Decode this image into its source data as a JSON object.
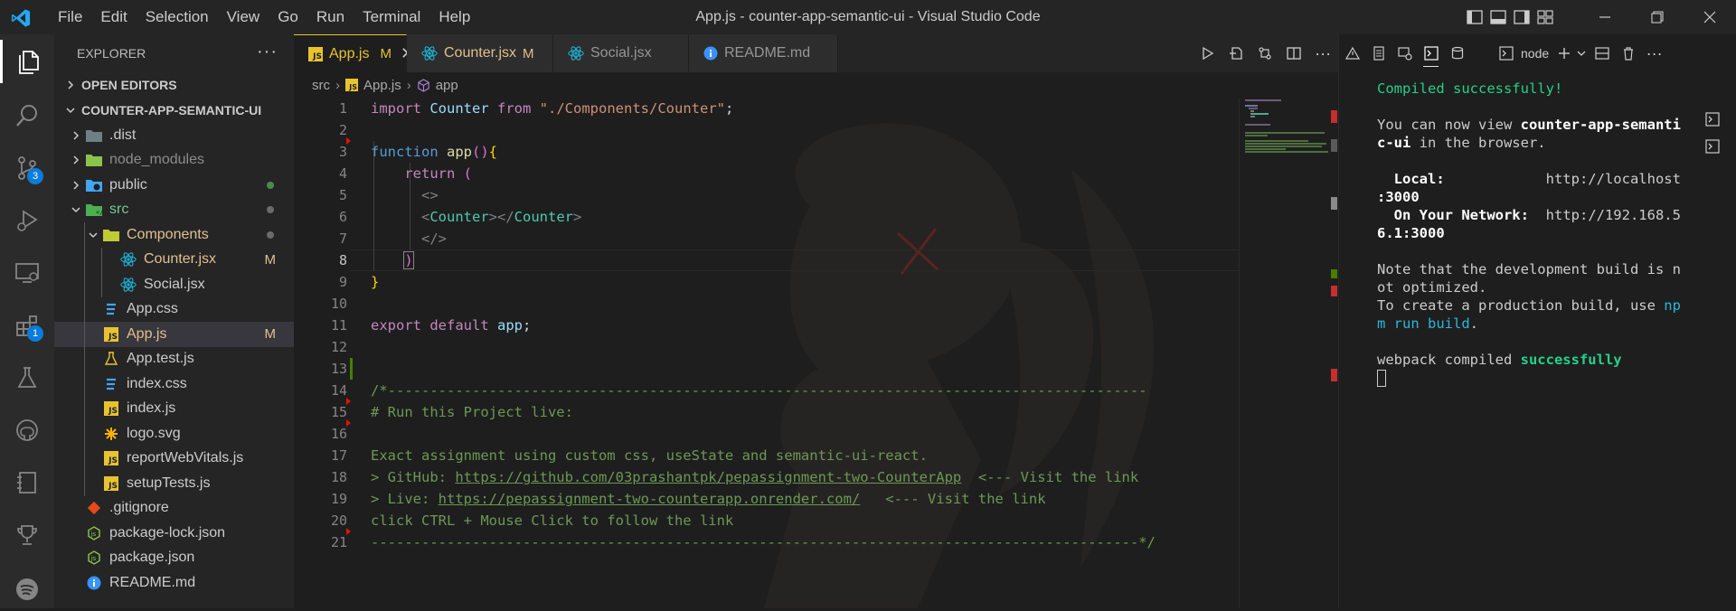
{
  "window": {
    "title": "App.js - counter-app-semantic-ui - Visual Studio Code"
  },
  "menu": [
    "File",
    "Edit",
    "Selection",
    "View",
    "Go",
    "Run",
    "Terminal",
    "Help"
  ],
  "activity_badges": {
    "source_control": "3",
    "extensions": "1"
  },
  "sidebar": {
    "title": "EXPLORER",
    "more": "···",
    "open_editors": "OPEN EDITORS",
    "project": "COUNTER-APP-SEMANTIC-UI",
    "tree": [
      {
        "label": ".dist",
        "indent": 1,
        "chevron": "right",
        "icon": "folder-dist",
        "decoration": ""
      },
      {
        "label": "node_modules",
        "indent": 1,
        "chevron": "right",
        "icon": "folder-node",
        "decoration": "",
        "dim": true
      },
      {
        "label": "public",
        "indent": 1,
        "chevron": "right",
        "icon": "folder-public",
        "decoration": "dot-green"
      },
      {
        "label": "src",
        "indent": 1,
        "chevron": "down",
        "icon": "folder-src",
        "decoration": "dot-grey",
        "color": "#73c991"
      },
      {
        "label": "Components",
        "indent": 2,
        "chevron": "down",
        "icon": "folder-components",
        "decoration": "dot-grey",
        "color": "#e2c08d"
      },
      {
        "label": "Counter.jsx",
        "indent": 3,
        "chevron": "",
        "icon": "react",
        "decoration": "M",
        "color": "#e2c08d"
      },
      {
        "label": "Social.jsx",
        "indent": 3,
        "chevron": "",
        "icon": "react",
        "decoration": ""
      },
      {
        "label": "App.css",
        "indent": 2,
        "chevron": "",
        "icon": "css",
        "decoration": ""
      },
      {
        "label": "App.js",
        "indent": 2,
        "chevron": "",
        "icon": "js",
        "decoration": "M",
        "color": "#e2c08d",
        "selected": true
      },
      {
        "label": "App.test.js",
        "indent": 2,
        "chevron": "",
        "icon": "test",
        "decoration": ""
      },
      {
        "label": "index.css",
        "indent": 2,
        "chevron": "",
        "icon": "css",
        "decoration": ""
      },
      {
        "label": "index.js",
        "indent": 2,
        "chevron": "",
        "icon": "js",
        "decoration": ""
      },
      {
        "label": "logo.svg",
        "indent": 2,
        "chevron": "",
        "icon": "svg",
        "decoration": ""
      },
      {
        "label": "reportWebVitals.js",
        "indent": 2,
        "chevron": "",
        "icon": "js",
        "decoration": ""
      },
      {
        "label": "setupTests.js",
        "indent": 2,
        "chevron": "",
        "icon": "js",
        "decoration": ""
      },
      {
        "label": ".gitignore",
        "indent": 1,
        "chevron": "",
        "icon": "git",
        "decoration": ""
      },
      {
        "label": "package-lock.json",
        "indent": 1,
        "chevron": "",
        "icon": "node",
        "decoration": ""
      },
      {
        "label": "package.json",
        "indent": 1,
        "chevron": "",
        "icon": "node",
        "decoration": ""
      },
      {
        "label": "README.md",
        "indent": 1,
        "chevron": "",
        "icon": "info",
        "decoration": ""
      }
    ]
  },
  "tabs": [
    {
      "label": "App.js",
      "status": "M",
      "icon": "js",
      "active": true,
      "close": "✕"
    },
    {
      "label": "Counter.jsx",
      "status": "M",
      "icon": "react",
      "active": false
    },
    {
      "label": "Social.jsx",
      "status": "",
      "icon": "react",
      "active": false
    },
    {
      "label": "README.md",
      "status": "",
      "icon": "info",
      "active": false
    }
  ],
  "breadcrumb": {
    "folder": "src",
    "file": "App.js",
    "symbol": "app"
  },
  "editor": {
    "line_numbers": [
      "1",
      "2",
      "3",
      "4",
      "5",
      "6",
      "7",
      "8",
      "9",
      "10",
      "11",
      "12",
      "13",
      "14",
      "15",
      "16",
      "17",
      "18",
      "19",
      "20",
      "21"
    ],
    "current_line": "8",
    "code": {
      "l1_import": "import",
      "l1_name": "Counter",
      "l1_from": "from",
      "l1_path": "\"./Components/Counter\"",
      "l1_semi": ";",
      "l3_function": "function",
      "l3_name": "app",
      "l3_parens": "()",
      "l3_brace": "{",
      "l4_return": "return",
      "l4_paren": "(",
      "l5_frag_open": "<>",
      "l6_lt": "<",
      "l6_tag_open": "Counter",
      "l6_gt_lt": "></",
      "l6_tag_close": "Counter",
      "l6_gt": ">",
      "l7_frag_close": "</>",
      "l8_paren": ")",
      "l9_brace": "}",
      "l11_export": "export",
      "l11_default": "default",
      "l11_name": "app",
      "l11_semi": ";",
      "l14": "/*------------------------------------------------------------------------------------------",
      "l15": "# Run this Project live:",
      "l17": "Exact assignment using custom css, useState and semantic-ui-react.",
      "l18_prefix": "> GitHub: ",
      "l18_link": "https://github.com/03prashantpk/pepassignment-two-CounterApp",
      "l18_suffix": "  <--- Visit the link",
      "l19_prefix": "> Live: ",
      "l19_link": "https://pepassignment-two-counterapp.onrender.com/",
      "l19_suffix": "   <--- Visit the link",
      "l20": "click CTRL + Mouse Click to follow the link",
      "l21": "-------------------------------------------------------------------------------------------*/"
    }
  },
  "panel": {
    "terminal_profile": "node",
    "lines": {
      "compiled": "Compiled successfully!",
      "view_1a": "You can now view ",
      "view_1b": "counter-app-semanti",
      "view_2a": "c-ui",
      "view_2b": " in the browser.",
      "local_label": "  Local:",
      "local_url_1": "http://localhost",
      "local_url_2": ":3000",
      "network_label": "  On Your Network:",
      "network_url_1": "http://192.168.5",
      "network_url_2": "6.1:3000",
      "note_1": "Note that the development build is n",
      "note_2": "ot optimized.",
      "prod_1a": "To create a production build, use ",
      "prod_1b": "np",
      "prod_2a": "m run build",
      "prod_2b": ".",
      "webpack_a": "webpack compiled ",
      "webpack_b": "successfully"
    }
  },
  "colors": {
    "accent": "#0a7ddb",
    "modified": "#e2c08d",
    "js_yellow": "#e8c330",
    "react_cyan": "#1fb1d6",
    "terminal_green": "#23d18b"
  }
}
